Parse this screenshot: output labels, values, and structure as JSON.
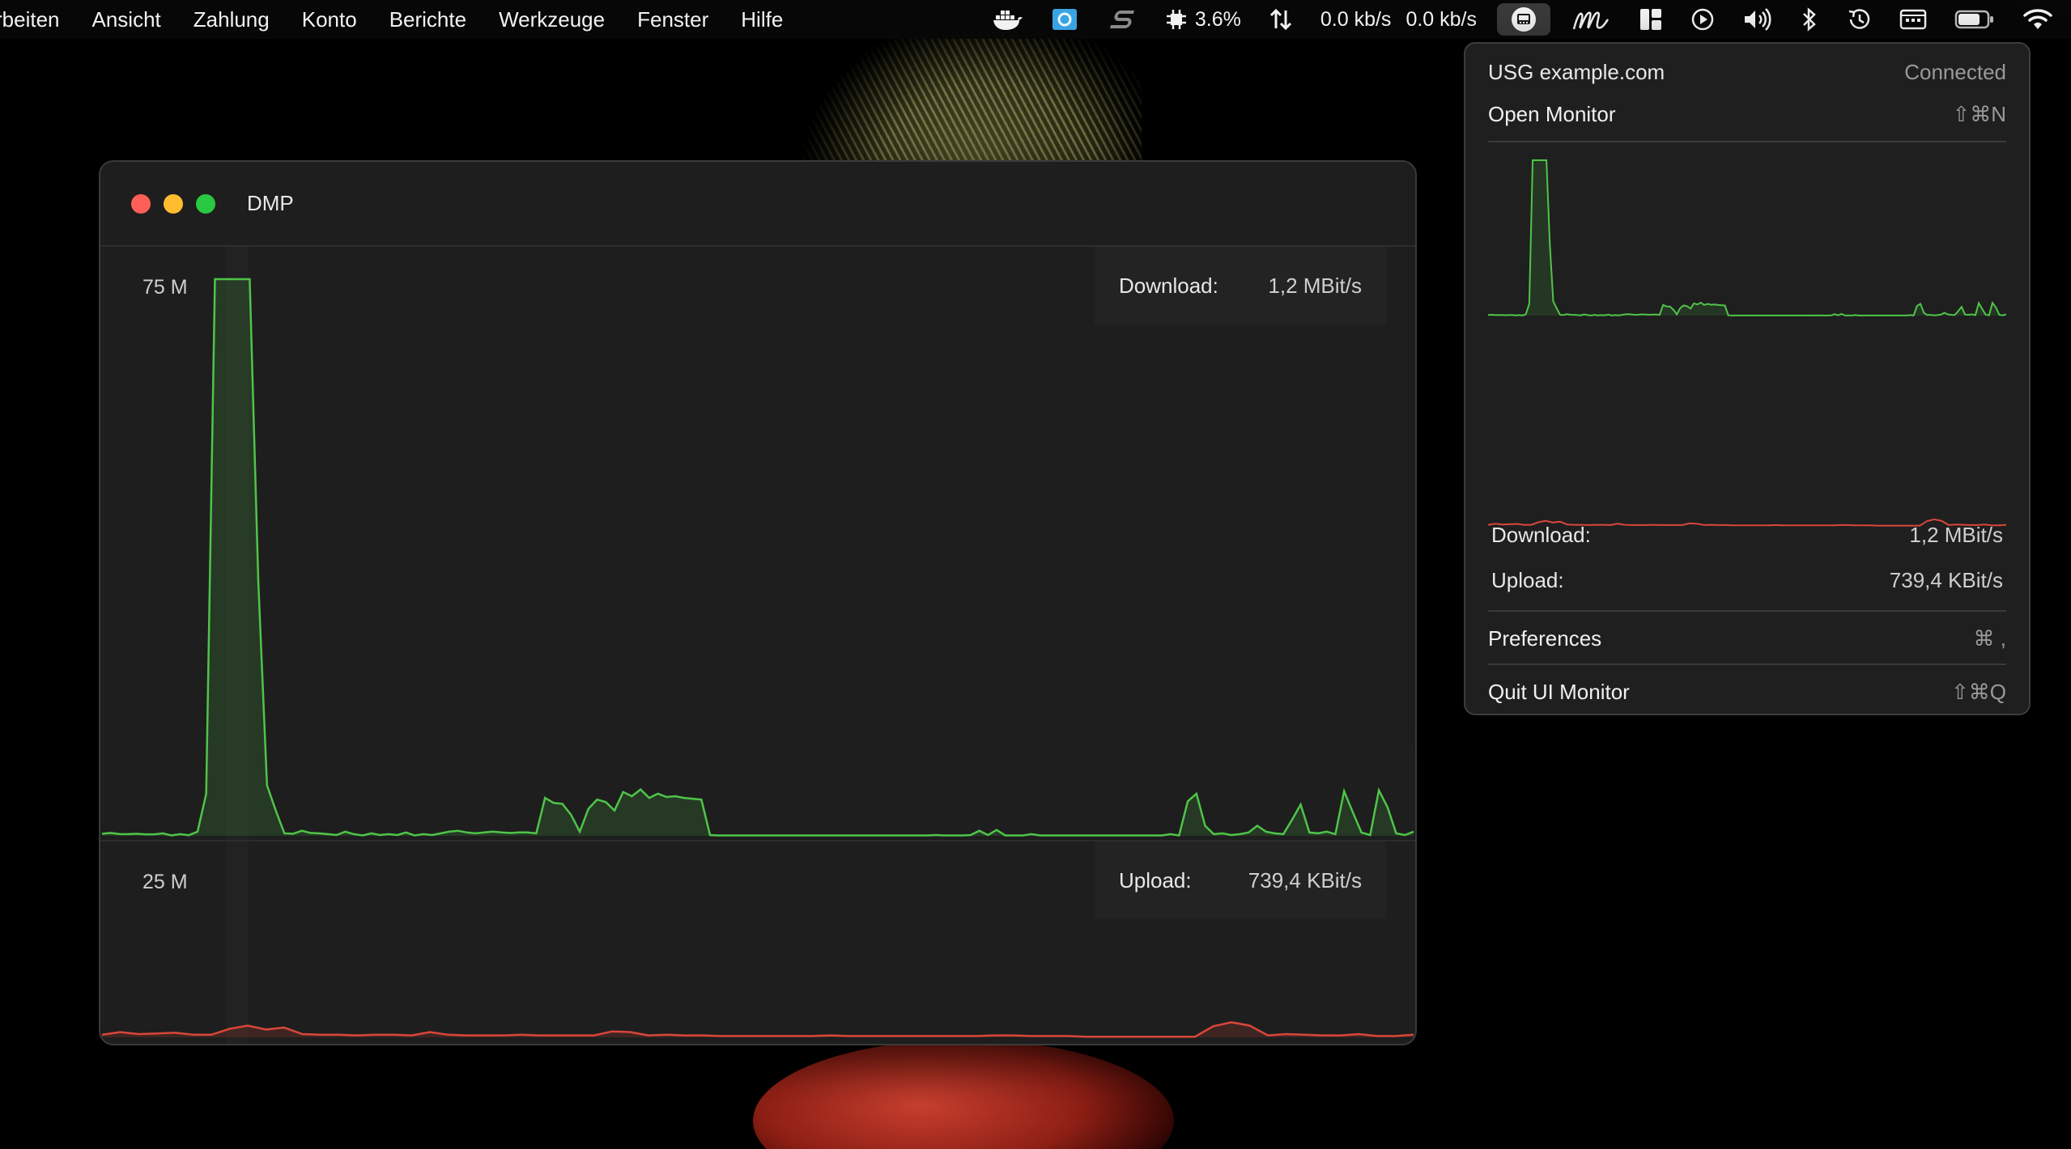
{
  "menubar": {
    "menus": [
      "rbeiten",
      "Ansicht",
      "Zahlung",
      "Konto",
      "Berichte",
      "Werkzeuge",
      "Fenster",
      "Hilfe"
    ],
    "cpu": "3.6%",
    "net_down": "0.0 kb/s",
    "net_up": "0.0 kb/s"
  },
  "window": {
    "title": "DMP",
    "download": {
      "scale": "75 M",
      "label": "Download:",
      "value": "1,2 MBit/s"
    },
    "upload": {
      "scale": "25 M",
      "label": "Upload:",
      "value": "739,4 KBit/s"
    }
  },
  "dropdown": {
    "gateway": "USG example.com",
    "status": "Connected",
    "open_monitor": "Open Monitor",
    "open_monitor_shortcut": "⇧⌘N",
    "download_label": "Download:",
    "download_value": "1,2 MBit/s",
    "upload_label": "Upload:",
    "upload_value": "739,4 KBit/s",
    "preferences": "Preferences",
    "preferences_shortcut": "⌘ ,",
    "quit": "Quit UI Monitor",
    "quit_shortcut": "⇧⌘Q"
  },
  "colors": {
    "download_line": "#4fc449",
    "upload_line": "#d9463a",
    "accent_close": "#fe5f57",
    "accent_min": "#febc2e",
    "accent_max": "#28c840"
  },
  "icons": [
    "docker-icon",
    "app-blue-icon",
    "s-logo-icon",
    "cpu-icon",
    "network-arrows-icon",
    "ui-monitor-icon",
    "script-m-icon",
    "layout-icon",
    "play-icon",
    "volume-icon",
    "bluetooth-icon",
    "time-machine-icon",
    "keyboard-icon",
    "battery-icon",
    "wifi-icon"
  ],
  "chart_data": [
    {
      "type": "area",
      "title": "",
      "series": [
        {
          "name": "Download",
          "values": [
            0.25,
            0.35,
            0.22,
            0.2,
            0.25,
            0.18,
            0.18,
            0.3,
            0.05,
            0.2,
            0.08,
            0.5,
            5,
            82,
            86,
            80,
            88,
            84,
            30,
            6,
            3,
            0.3,
            0.25,
            0.6,
            0.35,
            0.3,
            0.2,
            0.1,
            0.5,
            0.2,
            0.05,
            0.3,
            0.1,
            0.2,
            0.1,
            0.4,
            0.05,
            0.2,
            0.1,
            0.3,
            0.5,
            0.6,
            0.4,
            0.3,
            0.4,
            0.5,
            0.4,
            0.35,
            0.4,
            0.4,
            0.3,
            4.5,
            3.9,
            3.8,
            2.5,
            0.5,
            3.2,
            4.3,
            4.0,
            3.0,
            5.2,
            4.7,
            5.5,
            4.5,
            5.0,
            4.6,
            4.7,
            4.5,
            4.4,
            4.3,
            0.1,
            0.05,
            0.05,
            0.05,
            0.05,
            0.05,
            0.05,
            0.05,
            0.05,
            0.05,
            0.05,
            0.05,
            0.05,
            0.05,
            0.05,
            0.05,
            0.05,
            0.05,
            0.05,
            0.05,
            0.05,
            0.05,
            0.05,
            0.05,
            0.05,
            0.05,
            0.1,
            0.05,
            0.05,
            0.05,
            0.1,
            0.6,
            0.1,
            0.7,
            0.05,
            0.05,
            0.05,
            0.2,
            0.05,
            0.05,
            0.05,
            0.05,
            0.05,
            0.05,
            0.05,
            0.05,
            0.05,
            0.05,
            0.05,
            0.05,
            0.05,
            0.05,
            0.05,
            0.2,
            0.05,
            4.1,
            5.0,
            1.2,
            0.2,
            0.3,
            0.1,
            0.2,
            0.4,
            1.2,
            0.5,
            0.3,
            0.2,
            1.9,
            3.7,
            0.4,
            0.3,
            0.5,
            0.2,
            5.3,
            2.8,
            0.4,
            0.1,
            5.4,
            3.4,
            0.3,
            0.1,
            0.5
          ]
        },
        {
          "name": "Upload",
          "values": [
            0.4,
            0.8,
            0.5,
            0.6,
            0.7,
            0.4,
            0.4,
            1.3,
            1.8,
            1.2,
            1.5,
            0.5,
            0.4,
            0.4,
            0.3,
            0.4,
            0.4,
            0.3,
            0.8,
            0.4,
            0.3,
            0.3,
            0.3,
            0.4,
            0.3,
            0.3,
            0.3,
            0.3,
            0.9,
            0.8,
            0.3,
            0.4,
            0.3,
            0.3,
            0.2,
            0.2,
            0.2,
            0.2,
            0.2,
            0.2,
            0.3,
            0.2,
            0.2,
            0.2,
            0.2,
            0.2,
            0.2,
            0.2,
            0.2,
            0.3,
            0.3,
            0.2,
            0.2,
            0.2,
            0.1,
            0.1,
            0.1,
            0.1,
            0.1,
            0.1,
            0.1,
            1.7,
            2.3,
            1.8,
            0.3,
            0.5,
            0.4,
            0.3,
            0.3,
            0.5,
            0.2,
            0.2,
            0.4
          ]
        }
      ],
      "ylabel": "",
      "download_ylim": [
        0,
        75
      ],
      "upload_ylim": [
        0,
        25
      ],
      "grid": false,
      "legend": "none"
    }
  ]
}
